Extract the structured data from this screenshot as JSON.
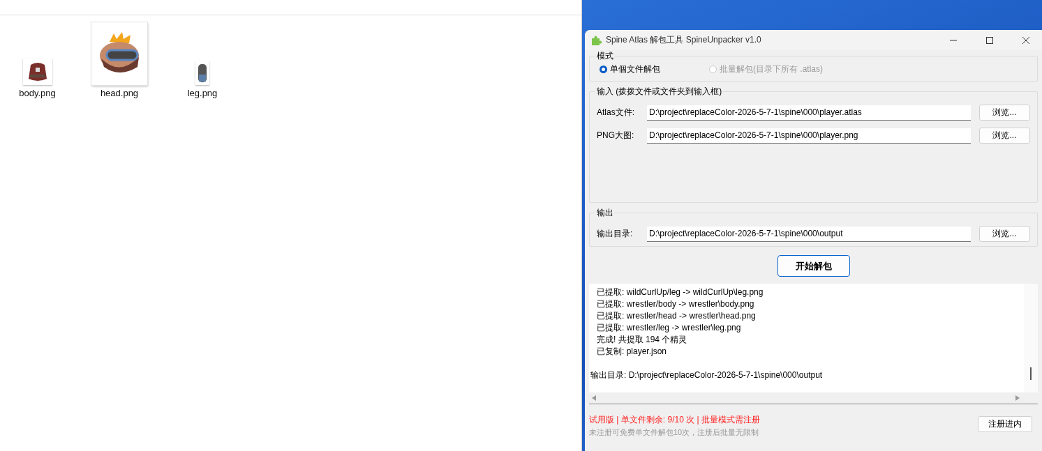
{
  "explorer": {
    "files": [
      {
        "name": "body.png",
        "kind": "body",
        "selected": false
      },
      {
        "name": "head.png",
        "kind": "head",
        "selected": true
      },
      {
        "name": "leg.png",
        "kind": "leg",
        "selected": false
      }
    ]
  },
  "window": {
    "title": "Spine Atlas 解包工具 SpineUnpacker v1.0",
    "mode": {
      "title": "模式",
      "options": [
        {
          "label": "单個文件解包",
          "selected": true,
          "disabled": false
        },
        {
          "label": "批量解包(目录下所有 .atlas)",
          "selected": false,
          "disabled": true
        }
      ]
    },
    "input": {
      "title": "输入 (拨拨文件或文件夹到输入框)",
      "fields": [
        {
          "label": "Atlas文件:",
          "value": "D:\\project\\replaceColor-2026-5-7-1\\spine\\000\\player.atlas",
          "button": "浏览..."
        },
        {
          "label": "PNG大图:",
          "value": "D:\\project\\replaceColor-2026-5-7-1\\spine\\000\\player.png",
          "button": "浏览..."
        }
      ]
    },
    "output": {
      "title": "输出",
      "fields": [
        {
          "label": "输出目录:",
          "value": "D:\\project\\replaceColor-2026-5-7-1\\spine\\000\\output",
          "button": "浏览..."
        }
      ]
    },
    "start_button": "开始解包",
    "log": [
      {
        "kind": "step",
        "text": "已提取: wildCurlUp/leg -> wildCurlUp\\leg.png"
      },
      {
        "kind": "step",
        "text": "已提取: wrestler/body -> wrestler\\body.png"
      },
      {
        "kind": "step",
        "text": "已提取: wrestler/head -> wrestler\\head.png"
      },
      {
        "kind": "step",
        "text": "已提取: wrestler/leg -> wrestler\\leg.png"
      },
      {
        "kind": "step",
        "text": "完成! 共提取 194 个精灵"
      },
      {
        "kind": "step",
        "text": "已复制: player.json"
      },
      {
        "kind": "summary",
        "text": "输出目录: D:\\project\\replaceColor-2026-5-7-1\\spine\\000\\output"
      }
    ],
    "status": {
      "trial": "试用版 | 单文件剩余: 9/10 次 | 批量模式需注册",
      "note": "未注册可免费单文件解包10次，注册后批量无限制",
      "register_button": "注册进内"
    }
  }
}
